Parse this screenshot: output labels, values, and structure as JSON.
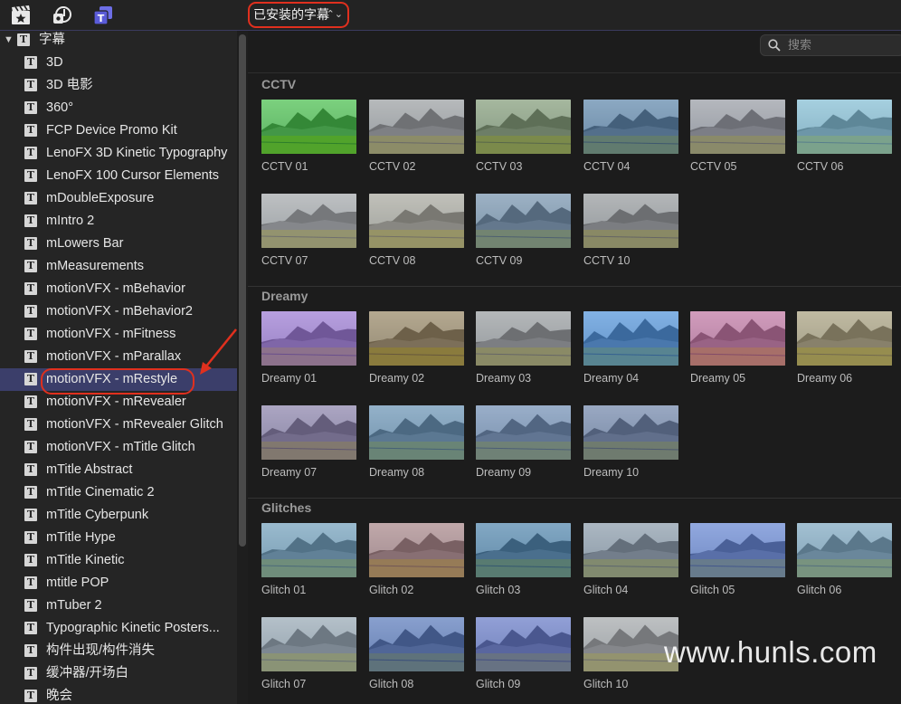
{
  "toolbar": {
    "icons": [
      "clapper-star-icon",
      "music-photo-icon",
      "titles-icon"
    ],
    "library_select": "已安装的字幕",
    "accent": "#e0301e"
  },
  "search": {
    "placeholder": "搜索"
  },
  "sidebar": {
    "root": "字幕",
    "items": [
      "3D",
      "3D 电影",
      "360°",
      "FCP Device Promo Kit",
      "LenoFX 3D Kinetic Typography",
      "LenoFX 100 Cursor Elements",
      "mDoubleExposure",
      "mIntro 2",
      "mLowers Bar",
      "mMeasurements",
      "motionVFX - mBehavior",
      "motionVFX - mBehavior2",
      "motionVFX - mFitness",
      "motionVFX - mParallax",
      "motionVFX - mRestyle",
      "motionVFX - mRevealer",
      "motionVFX - mRevealer Glitch",
      "motionVFX - mTitle Glitch",
      "mTitle Abstract",
      "mTitle Cinematic 2",
      "mTitle Cyberpunk",
      "mTitle Hype",
      "mTitle Kinetic",
      "mtitle POP",
      "mTuber 2",
      "Typographic Kinetic Posters...",
      "构件出现/构件消失",
      "缓冲器/开场白",
      "晚会"
    ],
    "selected": "motionVFX - mRestyle"
  },
  "sections": [
    {
      "title": "CCTV",
      "items": [
        "CCTV 01",
        "CCTV 02",
        "CCTV 03",
        "CCTV 04",
        "CCTV 05",
        "CCTV 06",
        "CCTV 07",
        "CCTV 08",
        "CCTV 09",
        "CCTV 10"
      ],
      "tints": [
        "#22b81f",
        "#8e8e8e",
        "#6f8a5a",
        "#3f6f9a",
        "#8a8a92",
        "#6fb6cf",
        "#9a9a9a",
        "#a09a8a",
        "#5f7f9f",
        "#888888"
      ]
    },
    {
      "title": "Dreamy",
      "items": [
        "Dreamy 01",
        "Dreamy 02",
        "Dreamy 03",
        "Dreamy 04",
        "Dreamy 05",
        "Dreamy 06",
        "Dreamy 07",
        "Dreamy 08",
        "Dreamy 09",
        "Dreamy 10"
      ],
      "tints": [
        "#8f5fd0",
        "#8a7040",
        "#8a8a8a",
        "#2f7fd8",
        "#c05a90",
        "#a09060",
        "#7a6a9a",
        "#4f7fa8",
        "#5a7aa8",
        "#5a6f9a"
      ]
    },
    {
      "title": "Glitches",
      "items": [
        "Glitch 01",
        "Glitch 02",
        "Glitch 03",
        "Glitch 04",
        "Glitch 05",
        "Glitch 06",
        "Glitch 07",
        "Glitch 08",
        "Glitch 09",
        "Glitch 10"
      ],
      "tints": [
        "#5a8fb0",
        "#a07070",
        "#2f6f9f",
        "#7a8a9a",
        "#4a6fd0",
        "#6a9ab8",
        "#8a9aa8",
        "#3a5fb0",
        "#4a5fc0",
        "#9a9a9a"
      ]
    }
  ],
  "watermark": "www.hunls.com"
}
